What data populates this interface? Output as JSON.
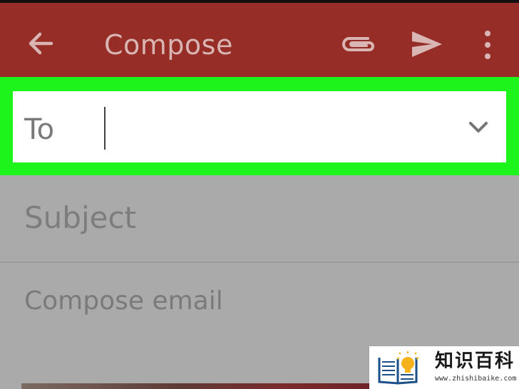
{
  "appbar": {
    "title": "Compose",
    "back_icon": "arrow-left-icon",
    "attach_icon": "paperclip-icon",
    "send_icon": "send-icon",
    "more_icon": "more-vertical-icon",
    "color": "#962e27"
  },
  "to_field": {
    "label": "To",
    "value": "",
    "dropdown_icon": "chevron-down-icon",
    "highlight_color": "#1cf41c"
  },
  "subject_field": {
    "placeholder": "Subject"
  },
  "body_field": {
    "placeholder": "Compose email"
  },
  "watermark": {
    "name": "知识百科",
    "url": "www.zhishibaike.com"
  }
}
